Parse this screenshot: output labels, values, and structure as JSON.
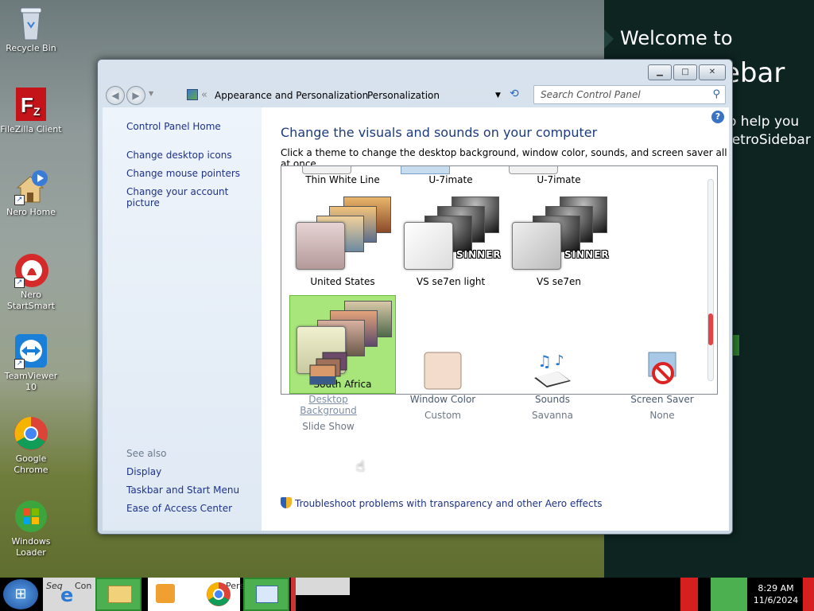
{
  "desktop": {
    "icons": [
      {
        "label": "Recycle Bin",
        "icon": "recycle-bin-icon"
      },
      {
        "label": "FileZilla Client",
        "icon": "filezilla-icon"
      },
      {
        "label": "Nero Home",
        "icon": "nero-home-icon"
      },
      {
        "label": "Nero StartSmart",
        "icon": "nero-startsmart-icon"
      },
      {
        "label": "TeamViewer 10",
        "icon": "teamviewer-icon"
      },
      {
        "label": "Google Chrome",
        "icon": "chrome-icon"
      },
      {
        "label": "Windows Loader",
        "icon": "windows-loader-icon"
      }
    ]
  },
  "sidebar_bg": {
    "line1": "Welcome to",
    "line2": "ebar",
    "line3": "o help you",
    "line4": "letroSidebar"
  },
  "window": {
    "address": {
      "crumb1": "Appearance and Personalization",
      "crumb2": "Personalization",
      "separator": "«"
    },
    "search_placeholder": "Search Control Panel",
    "left": {
      "home": "Control Panel Home",
      "links": [
        "Change desktop icons",
        "Change mouse pointers",
        "Change your account picture"
      ],
      "see_also_title": "See also",
      "see_also": [
        "Display",
        "Taskbar and Start Menu",
        "Ease of Access Center"
      ]
    },
    "heading": "Change the visuals and sounds on your computer",
    "subheading": "Click a theme to change the desktop background, window color, sounds, and screen saver all at once.",
    "themes": {
      "partial": [
        "Thin White Line",
        "U-7imate",
        "U-7imate"
      ],
      "row2": [
        "United States",
        "VS se7en light",
        "VS se7en"
      ],
      "row3": [
        "South Africa"
      ],
      "watermark": "SINNER",
      "selected": "South Africa"
    },
    "bottom": [
      {
        "label": "Desktop Background",
        "value": "Slide Show",
        "icon": "desktop-background-icon"
      },
      {
        "label": "Window Color",
        "value": "Custom",
        "icon": "window-color-icon"
      },
      {
        "label": "Sounds",
        "value": "Savanna",
        "icon": "sounds-icon"
      },
      {
        "label": "Screen Saver",
        "value": "None",
        "icon": "screen-saver-icon"
      }
    ],
    "troubleshoot": "Troubleshoot problems with transparency and other Aero effects"
  },
  "taskbar": {
    "search_text": "Seq",
    "item1_text": "Con",
    "item2_text": "Pers",
    "time": "8:29 AM",
    "date": "11/6/2024"
  },
  "colors": {
    "selected_theme": "#a8e67c",
    "link": "#1e3287",
    "taskbar": "#000000"
  }
}
